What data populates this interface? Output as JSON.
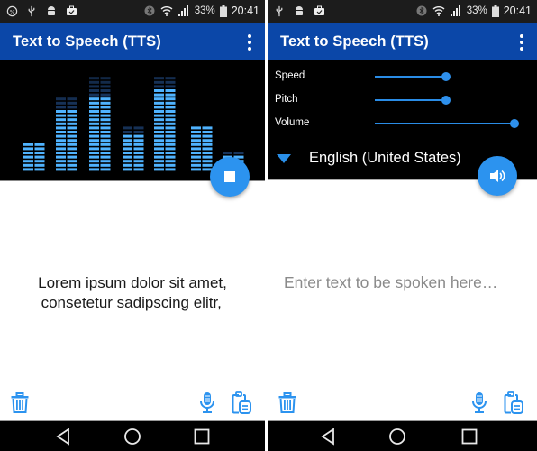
{
  "status_bar": {
    "battery": "33%",
    "time": "20:41",
    "left_icons": [
      "data-saver-icon",
      "usb-icon",
      "android-debug-icon",
      "work-briefcase-icon"
    ],
    "right_icons": [
      "bluetooth-icon",
      "wifi-icon",
      "signal-icon",
      "battery-charging-icon"
    ]
  },
  "app_bar": {
    "title": "Text to Speech (TTS)",
    "overflow_icon": "more-vert-icon"
  },
  "left_screen": {
    "visualizer": {
      "bar_levels": [
        0.28,
        0.64,
        0.75,
        0.36,
        0.84,
        0.46,
        0.18
      ],
      "peak_levels": [
        0.28,
        0.75,
        0.95,
        0.45,
        0.95,
        0.46,
        0.22
      ],
      "color": "#4fb3ff"
    },
    "fab": {
      "icon": "stop-icon"
    },
    "text": {
      "line1": "Lorem ipsum dolor sit amet,",
      "line2": "consetetur sadipscing elitr,"
    }
  },
  "right_screen": {
    "settings": [
      {
        "label": "Speed",
        "value": 0.43
      },
      {
        "label": "Pitch",
        "value": 0.43
      },
      {
        "label": "Volume",
        "value": 1.0
      }
    ],
    "language": "English (United States)",
    "fab": {
      "icon": "volume-up-icon"
    },
    "input": {
      "placeholder": "Enter text to be spoken here…",
      "value": ""
    }
  },
  "toolbar": {
    "icons": [
      "trash-icon",
      "mic-icon",
      "clipboard-paste-icon"
    ]
  },
  "navigation": [
    "back",
    "home",
    "recents"
  ],
  "colors": {
    "app_bar": "#0b47a8",
    "accent": "#2c93ef",
    "status_bar": "#1c1c1c"
  }
}
